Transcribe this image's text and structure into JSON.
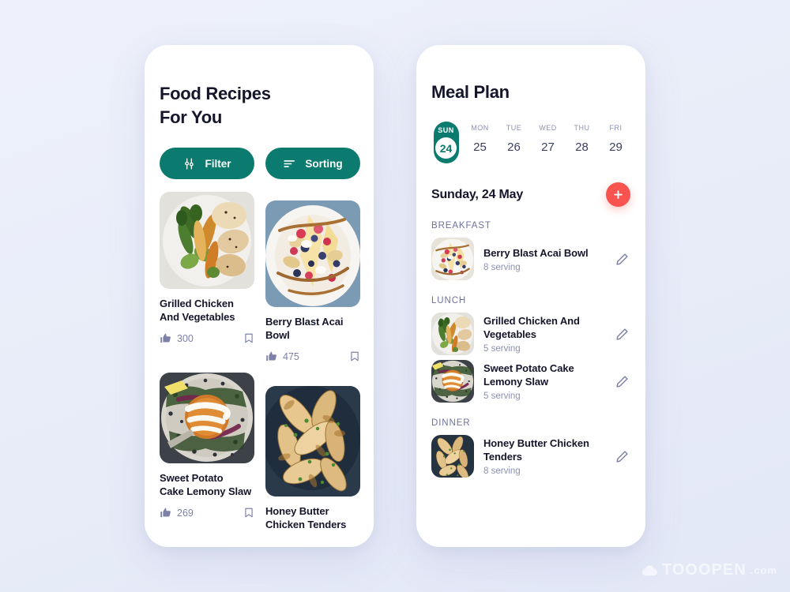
{
  "background": {
    "color": "#e9edf9"
  },
  "theme": {
    "teal": "#0b7a6f",
    "coral": "#f8534e",
    "dark": "#15152b",
    "muted": "#8d91b2"
  },
  "left_panel": {
    "title_line1": "Food Recipes",
    "title_line2": "For You",
    "search_icon": "search-icon",
    "buttons": [
      {
        "label": "Filter",
        "icon": "tune-icon"
      },
      {
        "label": "Sorting",
        "icon": "sort-icon"
      }
    ],
    "recipes": [
      {
        "name_line1": "Grilled Chicken",
        "name_line2": "And Vegetables",
        "likes": "300",
        "like_icon": "thumbs-up-icon",
        "save_icon": "bookmark-icon"
      },
      {
        "name_line1": "Berry Blast Acai",
        "name_line2": "Bowl",
        "likes": "475",
        "like_icon": "thumbs-up-icon",
        "save_icon": "bookmark-icon"
      },
      {
        "name_line1": "Sweet Potato",
        "name_line2": "Cake Lemony Slaw",
        "likes": "269",
        "like_icon": "thumbs-up-icon",
        "save_icon": "bookmark-icon"
      },
      {
        "name_line1": "Honey Butter",
        "name_line2": "Chicken Tenders",
        "likes": "",
        "like_icon": "thumbs-up-icon",
        "save_icon": "bookmark-icon"
      }
    ]
  },
  "right_panel": {
    "title": "Meal Plan",
    "days": [
      {
        "dow": "SUN",
        "num": "24",
        "selected": true
      },
      {
        "dow": "MON",
        "num": "25",
        "selected": false
      },
      {
        "dow": "TUE",
        "num": "26",
        "selected": false
      },
      {
        "dow": "WED",
        "num": "27",
        "selected": false
      },
      {
        "dow": "THU",
        "num": "28",
        "selected": false
      },
      {
        "dow": "FRI",
        "num": "29",
        "selected": false
      }
    ],
    "selected_date": "Sunday, 24 May",
    "add_label": "+",
    "add_icon": "plus-icon",
    "sections": [
      {
        "label": "BREAKFAST",
        "items": [
          {
            "name_line1": "Berry Blast Acai Bowl",
            "name_line2": "",
            "servings": "8 serving",
            "edit_icon": "pencil-icon"
          }
        ]
      },
      {
        "label": "LUNCH",
        "items": [
          {
            "name_line1": "Grilled Chicken And",
            "name_line2": "Vegetables",
            "servings": "5 serving",
            "edit_icon": "pencil-icon"
          },
          {
            "name_line1": "Sweet Potato Cake",
            "name_line2": "Lemony Slaw",
            "servings": "5 serving",
            "edit_icon": "pencil-icon"
          }
        ]
      },
      {
        "label": "DINNER",
        "items": [
          {
            "name_line1": "Honey Butter Chicken",
            "name_line2": "Tenders",
            "servings": "8 serving",
            "edit_icon": "pencil-icon"
          }
        ]
      }
    ]
  },
  "watermark": {
    "text": "TOOOPEN",
    "domain": ".com",
    "icon": "cloud-icon"
  }
}
